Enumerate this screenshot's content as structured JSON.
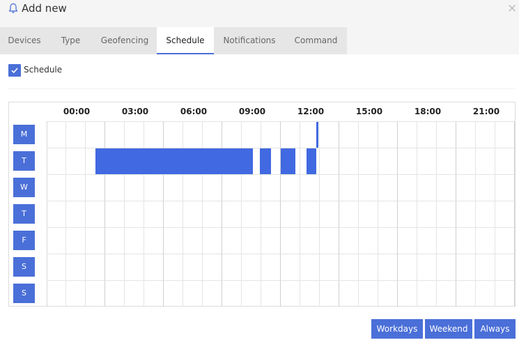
{
  "modal": {
    "title": "Add new",
    "close_glyph": "×",
    "title_icon": "bell-icon",
    "accent_color": "#4a6fd8"
  },
  "tabs": [
    {
      "label": "Devices",
      "active": false
    },
    {
      "label": "Type",
      "active": false
    },
    {
      "label": "Geofencing",
      "active": false
    },
    {
      "label": "Schedule",
      "active": true
    },
    {
      "label": "Notifications",
      "active": false
    },
    {
      "label": "Command",
      "active": false
    }
  ],
  "schedule_toggle": {
    "label": "Schedule",
    "checked": true
  },
  "schedule": {
    "hour_labels": [
      "00:00",
      "03:00",
      "06:00",
      "09:00",
      "12:00",
      "15:00",
      "18:00",
      "21:00"
    ],
    "days": [
      "M",
      "T",
      "W",
      "T",
      "F",
      "S",
      "S"
    ],
    "active_ranges": [
      {
        "day_index": 0,
        "ranges": [
          [
            "13:50",
            "13:55"
          ]
        ]
      },
      {
        "day_index": 1,
        "ranges": [
          [
            "02:30",
            "10:35"
          ],
          [
            "10:55",
            "11:30"
          ],
          [
            "12:00",
            "12:15"
          ],
          [
            "12:15",
            "12:45"
          ],
          [
            "13:20",
            "13:50"
          ]
        ]
      }
    ]
  },
  "buttons": {
    "workdays": "Workdays",
    "weekend": "Weekend",
    "always": "Always"
  }
}
